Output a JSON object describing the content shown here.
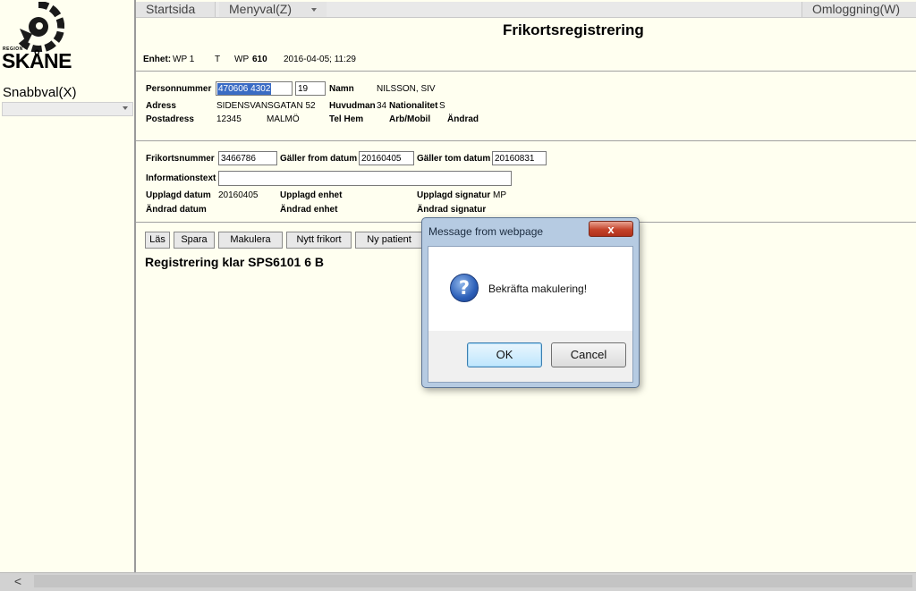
{
  "sidebar": {
    "logo_region": "REGION",
    "logo_name": "SKÅNE",
    "snabbval_label": "Snabbval(X)",
    "snabbval_value": ""
  },
  "menu": {
    "startsida": "Startsida",
    "menyval": "Menyval(Z)",
    "omloggning": "Omloggning(W)"
  },
  "page": {
    "title": "Frikortsregistrering",
    "enhet_label": "Enhet:",
    "enhet_value": "WP 1",
    "t_value": "T",
    "wp_label": "WP",
    "wp_value": "610",
    "datetime": "2016-04-05; 11:29"
  },
  "patient": {
    "personnummer_label": "Personnummer",
    "personnummer_value": "470606 4302",
    "personnummer_extra": "19",
    "namn_label": "Namn",
    "namn_value": "NILSSON, SIV",
    "adress_label": "Adress",
    "adress_value": "SIDENSVANSGATAN 52",
    "huvudman_label": "Huvudman",
    "huvudman_value": "34",
    "nationalitet_label": "Nationalitet",
    "nationalitet_value": "S",
    "postadress_label": "Postadress",
    "postnummer_value": "12345",
    "ort_value": "MALMÖ",
    "telhem_label": "Tel Hem",
    "arbmobil_label": "Arb/Mobil",
    "andrad_label": "Ändrad"
  },
  "frikort": {
    "nummer_label": "Frikortsnummer",
    "nummer_value": "3466786",
    "from_label": "Gäller from datum",
    "from_value": "20160405",
    "tom_label": "Gäller tom datum",
    "tom_value": "20160831",
    "info_label": "Informationstext",
    "info_value": "",
    "upplagd_datum_label": "Upplagd datum",
    "upplagd_datum_value": "20160405",
    "upplagd_enhet_label": "Upplagd enhet",
    "upplagd_signatur_label": "Upplagd signatur",
    "upplagd_signatur_value": "MP",
    "andrad_datum_label": "Ändrad datum",
    "andrad_enhet_label": "Ändrad enhet",
    "andrad_signatur_label": "Ändrad signatur"
  },
  "buttons": {
    "las": "Läs",
    "spara": "Spara",
    "makulera": "Makulera",
    "nytt_frikort": "Nytt frikort",
    "ny_patient": "Ny patient"
  },
  "status_message": "Registrering klar SPS6101 6 B",
  "dialog": {
    "title": "Message from webpage",
    "close": "x",
    "message": "Bekräfta makulering!",
    "icon": "question-icon",
    "ok": "OK",
    "cancel": "Cancel"
  },
  "scrollbar": {
    "left_arrow": "<"
  },
  "colors": {
    "page_background": "#fffff0",
    "dialog_frame": "#b6cbe2",
    "close_button": "#c4432a",
    "selection": "#3a6bc4"
  }
}
